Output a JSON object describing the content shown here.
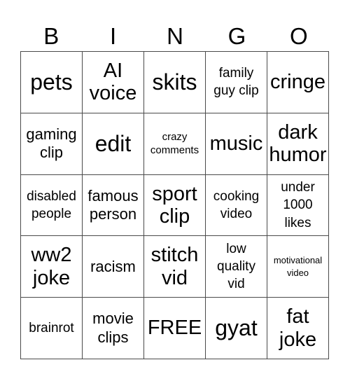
{
  "header": [
    "B",
    "I",
    "N",
    "G",
    "O"
  ],
  "cells": [
    [
      {
        "text": "pets",
        "size": "xl"
      },
      {
        "text": "AI voice",
        "size": "lg"
      },
      {
        "text": "skits",
        "size": "xl"
      },
      {
        "text": "family guy clip",
        "size": "sm"
      },
      {
        "text": "cringe",
        "size": "lg"
      }
    ],
    [
      {
        "text": "gaming clip",
        "size": "md"
      },
      {
        "text": "edit",
        "size": "xl"
      },
      {
        "text": "crazy comments",
        "size": "xs"
      },
      {
        "text": "music",
        "size": "lg"
      },
      {
        "text": "dark humor",
        "size": "lg"
      }
    ],
    [
      {
        "text": "disabled people",
        "size": "sm"
      },
      {
        "text": "famous person",
        "size": "md"
      },
      {
        "text": "sport clip",
        "size": "lg"
      },
      {
        "text": "cooking video",
        "size": "sm"
      },
      {
        "text": "under 1000 likes",
        "size": "sm"
      }
    ],
    [
      {
        "text": "ww2 joke",
        "size": "lg"
      },
      {
        "text": "racism",
        "size": "md"
      },
      {
        "text": "stitch vid",
        "size": "lg"
      },
      {
        "text": "low quality vid",
        "size": "sm"
      },
      {
        "text": "motivational video",
        "size": "xxs"
      }
    ],
    [
      {
        "text": "brainrot",
        "size": "sm"
      },
      {
        "text": "movie clips",
        "size": "md"
      },
      {
        "text": "FREE",
        "size": "lg"
      },
      {
        "text": "gyat",
        "size": "xl"
      },
      {
        "text": "fat joke",
        "size": "lg"
      }
    ]
  ]
}
